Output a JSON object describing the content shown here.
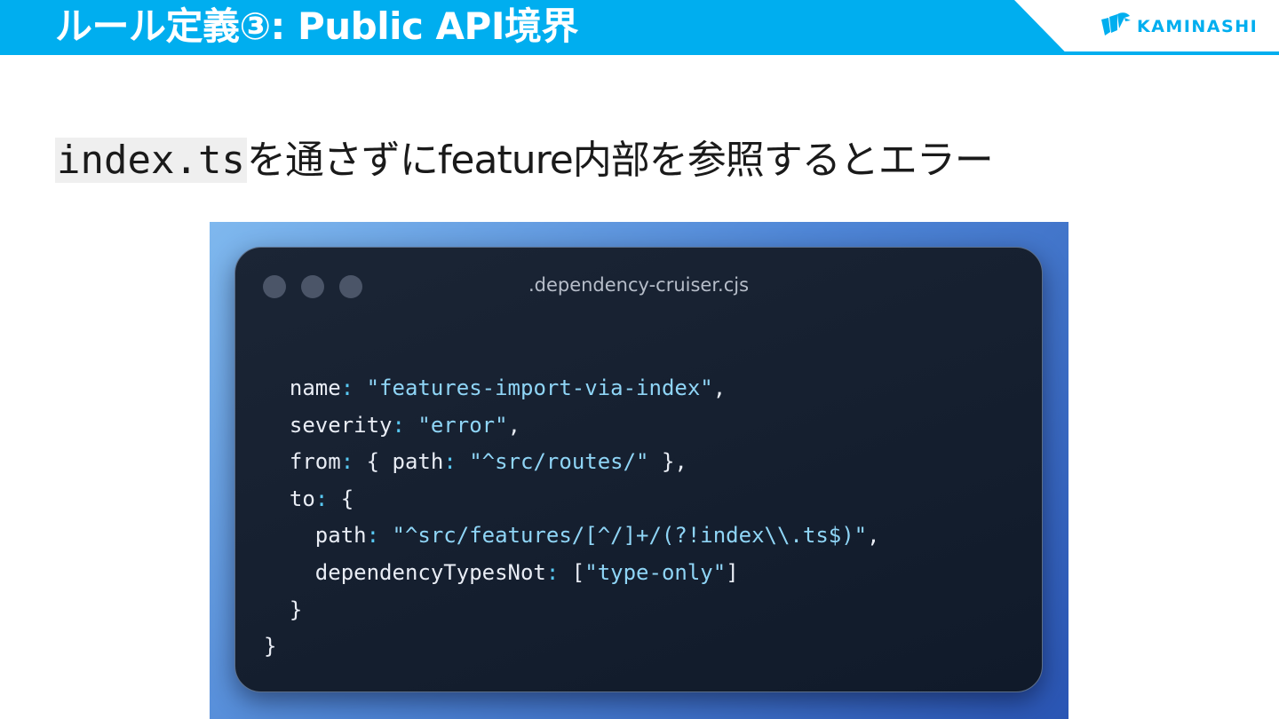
{
  "header": {
    "title": "ルール定義③: Public API境界",
    "logo_text": "KAMINASHI",
    "logo_icon": "kaminashi-bird-icon"
  },
  "subtitle": {
    "code": "index.ts",
    "text": "を通さずにfeature内部を参照するとエラー"
  },
  "code_window": {
    "filename": ".dependency-cruiser.cjs",
    "lines": [
      {
        "indent": "  ",
        "key": "name",
        "colon": ":",
        "sep": " ",
        "value": "\"features-import-via-index\"",
        "tail": ","
      },
      {
        "indent": "  ",
        "key": "severity",
        "colon": ":",
        "sep": " ",
        "value": "\"error\"",
        "tail": ","
      },
      {
        "indent": "  ",
        "key": "from",
        "colon": ":",
        "sep": " { ",
        "key2": "path",
        "colon2": ":",
        "sep2": " ",
        "value": "\"^src/routes/\"",
        "tail": " },"
      },
      {
        "indent": "  ",
        "key": "to",
        "colon": ":",
        "sep": " {",
        "value": "",
        "tail": ""
      },
      {
        "indent": "    ",
        "key": "path",
        "colon": ":",
        "sep": " ",
        "value": "\"^src/features/[^/]+/(?!index\\\\.ts$)\"",
        "tail": ","
      },
      {
        "indent": "    ",
        "key": "dependencyTypesNot",
        "colon": ":",
        "sep": " [",
        "value": "\"type-only\"",
        "tail": "]"
      },
      {
        "indent": "  ",
        "key": "}",
        "colon": "",
        "sep": "",
        "value": "",
        "tail": ""
      },
      {
        "indent": "",
        "key": "}",
        "colon": "",
        "sep": "",
        "value": "",
        "tail": ""
      }
    ]
  },
  "colors": {
    "header_blue": "#00aeef",
    "code_bg": "#141e2e",
    "string": "#8fd5f6",
    "colon_accent": "#58c8f2"
  }
}
